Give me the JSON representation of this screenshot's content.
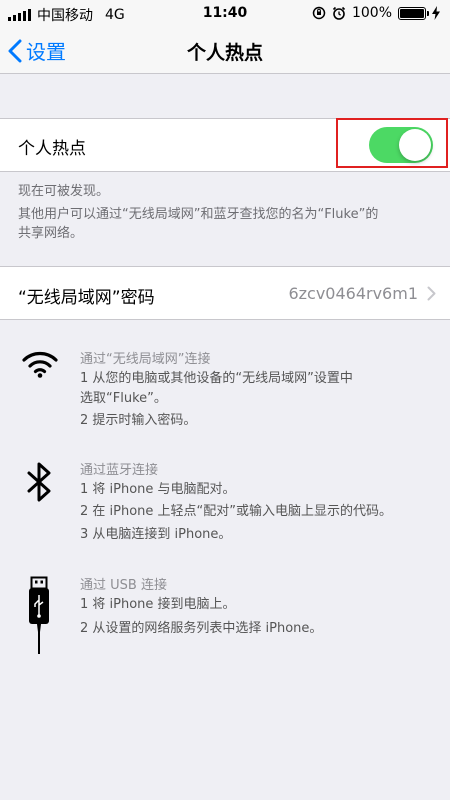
{
  "status_bar": {
    "carrier": "中国移动",
    "network": "4G",
    "time": "11:40",
    "battery": "100%"
  },
  "nav": {
    "back_label": "设置",
    "title": "个人热点"
  },
  "hotspot": {
    "label": "个人热点",
    "enabled": true,
    "toggle_color": "#4cd964",
    "highlight_color": "#e02020"
  },
  "discoverable": {
    "line1": "现在可被发现。",
    "line2": "其他用户可以通过“无线局域网”和蓝牙查找您的名为“Fluke”的",
    "line3": "共享网络。"
  },
  "wifi_password": {
    "label": "“无线局域网”密码",
    "value": "6zcv0464rv6m1"
  },
  "connections": {
    "wifi": {
      "icon": "wifi-icon",
      "title": "通过“无线局域网”连接",
      "step1_line1": "1 从您的电脑或其他设备的“无线局域网”设置中",
      "step1_line2": "选取“Fluke”。",
      "step2": "2 提示时输入密码。"
    },
    "bluetooth": {
      "icon": "bluetooth-icon",
      "title": "通过蓝牙连接",
      "step1": "1 将 iPhone 与电脑配对。",
      "step2": "2 在 iPhone 上轻点“配对”或输入电脑上显示的代码。",
      "step3": "3 从电脑连接到 iPhone。"
    },
    "usb": {
      "icon": "usb-cable-icon",
      "title": "通过 USB 连接",
      "step1": "1 将 iPhone 接到电脑上。",
      "step2": "2 从设置的网络服务列表中选择 iPhone。"
    }
  },
  "colors": {
    "accent": "#007aff",
    "background": "#efeff4"
  }
}
